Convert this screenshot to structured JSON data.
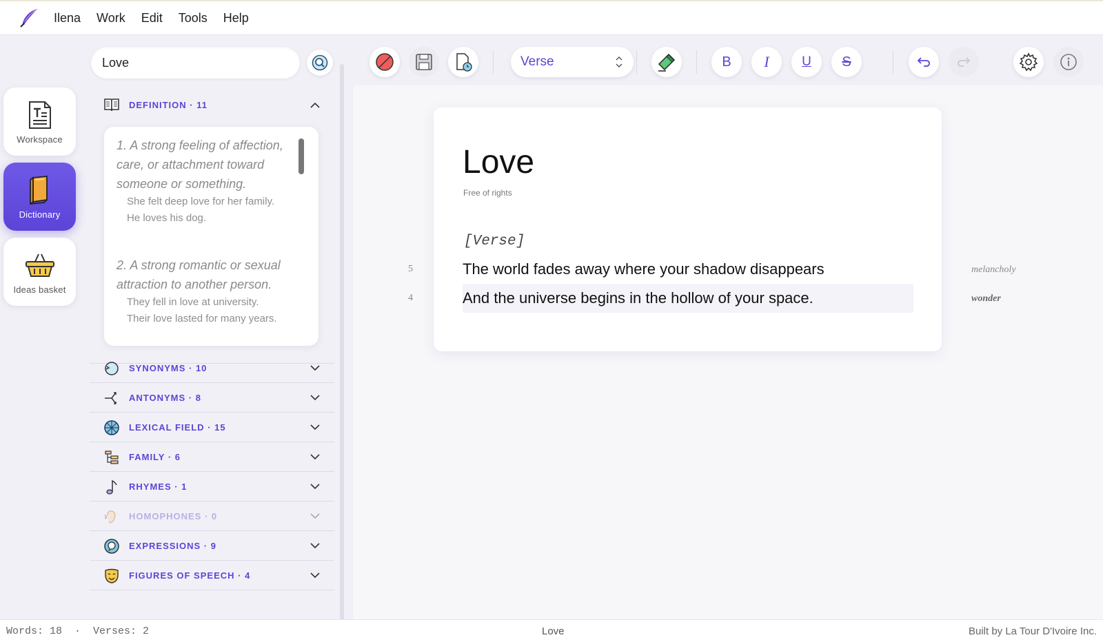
{
  "menubar": {
    "app_name": "Ilena",
    "items": [
      "Work",
      "Edit",
      "Tools",
      "Help"
    ]
  },
  "leftnav": {
    "items": [
      {
        "label": "Workspace",
        "active": false
      },
      {
        "label": "Dictionary",
        "active": true
      },
      {
        "label": "Ideas basket",
        "active": false
      }
    ]
  },
  "dictionary": {
    "search_value": "Love",
    "sections": [
      {
        "title": "DEFINITION · 11",
        "expanded": true,
        "icon": "book-icon"
      },
      {
        "title": "SYNONYMS · 10",
        "expanded": false,
        "icon": "cycle-icon"
      },
      {
        "title": "ANTONYMS · 8",
        "expanded": false,
        "icon": "fork-icon"
      },
      {
        "title": "LEXICAL FIELD · 15",
        "expanded": false,
        "icon": "globe-icon"
      },
      {
        "title": "FAMILY · 6",
        "expanded": false,
        "icon": "family-tree-icon"
      },
      {
        "title": "RHYMES · 1",
        "expanded": false,
        "icon": "music-note-icon"
      },
      {
        "title": "HOMOPHONES · 0",
        "expanded": false,
        "disabled": true,
        "icon": "ear-icon"
      },
      {
        "title": "EXPRESSIONS · 9",
        "expanded": false,
        "icon": "speech-icon"
      },
      {
        "title": "FIGURES OF SPEECH · 4",
        "expanded": false,
        "icon": "theater-mask-icon"
      }
    ],
    "definitions": [
      {
        "text": "1. A strong feeling of affection, care, or attachment toward someone or something.",
        "examples": [
          "She felt deep love for her family.",
          "He loves his dog."
        ]
      },
      {
        "text": "2. A strong romantic or sexual attraction to another person.",
        "examples": [
          "They fell in love at university.",
          "Their love lasted for many years."
        ]
      }
    ]
  },
  "toolbar": {
    "section_type": "Verse",
    "buttons": [
      "clear-button",
      "save-button",
      "history-button",
      "highlight-button",
      "bold-button",
      "italic-button",
      "underline-button",
      "strikethrough-button",
      "undo-button",
      "redo-button",
      "settings-button",
      "info-button"
    ],
    "bold_glyph": "B",
    "italic_glyph": "I",
    "underline_glyph": "U",
    "strike_glyph": "S"
  },
  "document": {
    "title": "Love",
    "rights": "Free of rights",
    "section_tag": "[Verse]",
    "lines": [
      {
        "count": "5",
        "text": "The world fades away where your shadow disappears",
        "note": "melancholy",
        "highlight": false
      },
      {
        "count": "4",
        "text": "And the universe begins in the hollow of your space.",
        "note": "wonder",
        "highlight": true
      }
    ]
  },
  "statusbar": {
    "stats": "Words: 18  ·  Verses: 2",
    "current": "Love",
    "credit": "Built by La Tour D'Ivoire Inc."
  },
  "colors": {
    "accent": "#5b45d6",
    "background": "#f1f0f6"
  }
}
